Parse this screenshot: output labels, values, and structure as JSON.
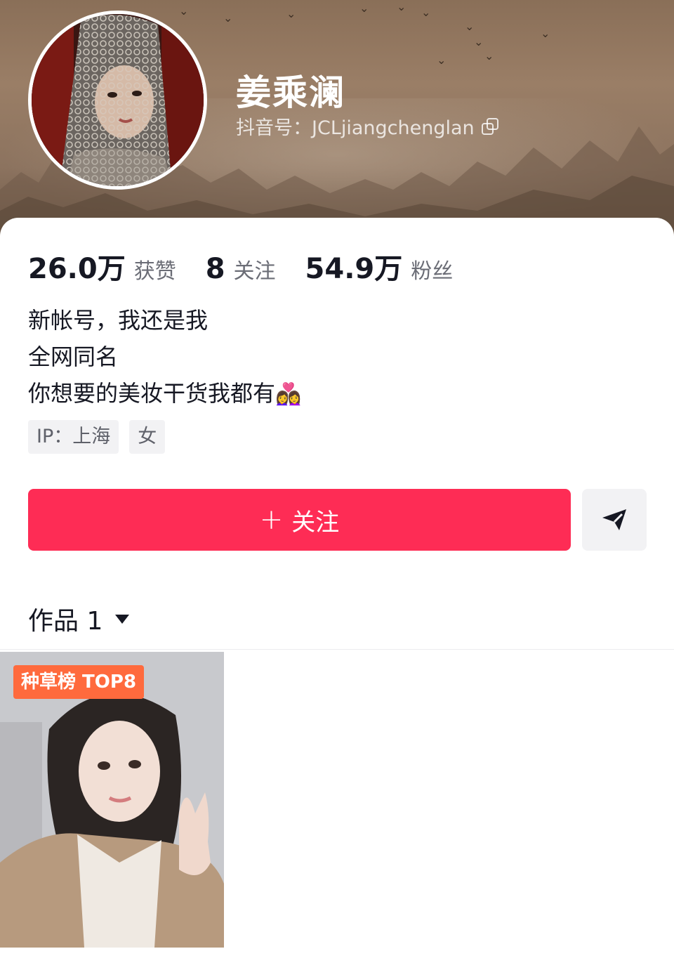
{
  "profile": {
    "name": "姜乘澜",
    "handle_label": "抖音号：JCLjiangchenglan",
    "copy_icon": "copy-icon",
    "avatar_icon": "avatar"
  },
  "stats": [
    {
      "value": "26.0万",
      "label": "获赞"
    },
    {
      "value": "8",
      "label": "关注"
    },
    {
      "value": "54.9万",
      "label": "粉丝"
    }
  ],
  "bio": {
    "lines": [
      "新帐号，我还是我",
      "全网同名",
      "你想要的美妆干货我都有"
    ],
    "emoji": "👩‍❤️‍👩"
  },
  "tags": [
    "IP：上海",
    "女"
  ],
  "actions": {
    "follow_label": "关注",
    "follow_icon": "plus-icon",
    "share_icon": "send-icon"
  },
  "tabs": {
    "works_label": "作品 1",
    "dropdown_icon": "caret-down-icon"
  },
  "videos": [
    {
      "badge": "种草榜 TOP8"
    }
  ],
  "colors": {
    "accent": "#fe2c55",
    "badge": "#ff6a3d",
    "secondary_text": "#6b6d76",
    "tag_bg": "#f2f2f4"
  }
}
